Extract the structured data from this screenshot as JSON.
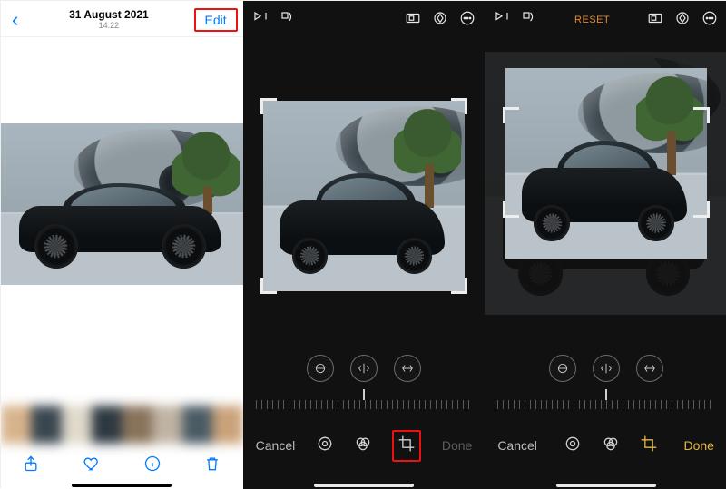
{
  "pane1": {
    "date": "31 August 2021",
    "time": "14:22",
    "edit_label": "Edit",
    "toolbar": {
      "share": "share-icon",
      "favorite": "heart-icon",
      "info": "info-icon",
      "delete": "trash-icon"
    }
  },
  "pane2": {
    "header_icons": {
      "flip_vertical": "flip-vertical-icon",
      "rotate": "rotate-icon",
      "aspect": "aspect-ratio-icon",
      "markup": "markup-icon",
      "more": "more-icon"
    },
    "circ_buttons": {
      "straighten": "straighten-icon",
      "flip_h": "flip-horizontal-icon",
      "flip_v": "perspective-icon"
    },
    "footer": {
      "cancel": "Cancel",
      "done": "Done",
      "tools": {
        "adjust": "adjust-dial-icon",
        "filters": "filters-icon",
        "crop": "crop-icon"
      }
    }
  },
  "pane3": {
    "reset": "RESET",
    "footer_done": "Done",
    "footer_cancel": "Cancel"
  },
  "colors": {
    "ios_blue": "#007aff",
    "highlight_red": "#e11",
    "gold": "#e2b642",
    "reset_orange": "#e08a2e"
  }
}
